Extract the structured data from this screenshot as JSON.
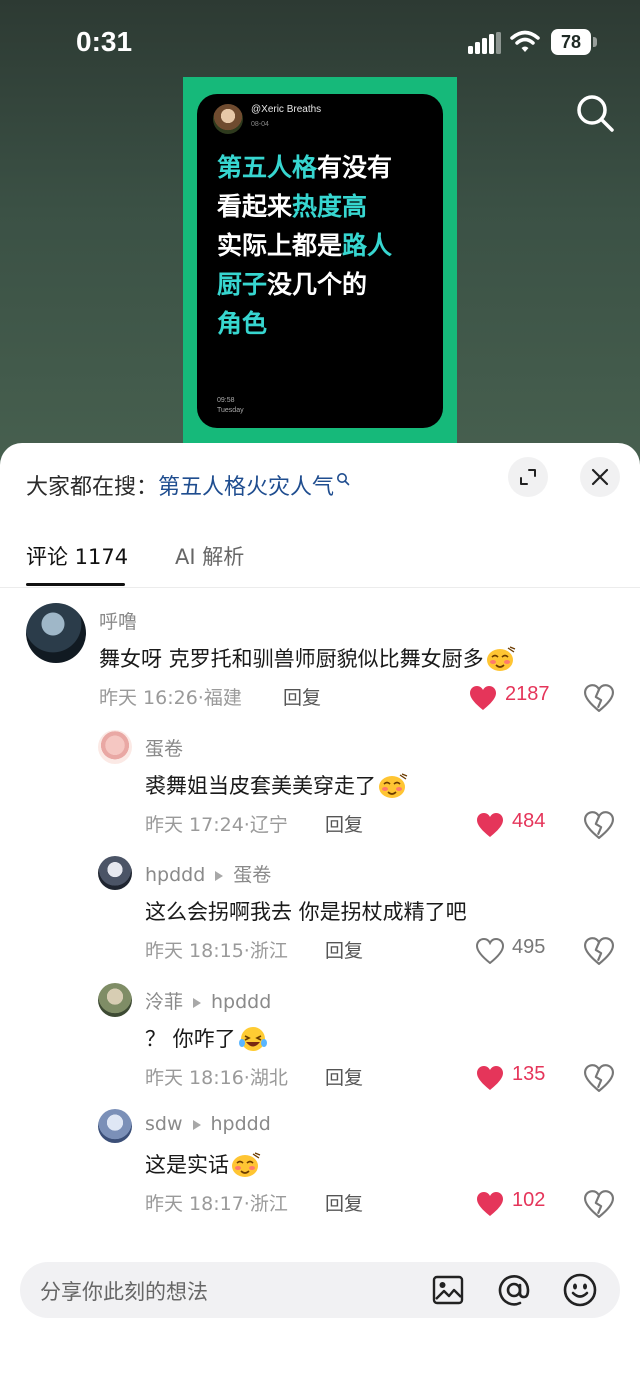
{
  "status": {
    "time": "0:31",
    "battery": "78"
  },
  "post": {
    "handle": "@Xeric Breaths",
    "date": "08-04",
    "lines": [
      [
        {
          "t": "第五人格",
          "hl": true
        },
        {
          "t": "有没有",
          "hl": false
        }
      ],
      [
        {
          "t": "看起来",
          "hl": false
        },
        {
          "t": "热度高",
          "hl": true
        }
      ],
      [
        {
          "t": "实际上都是",
          "hl": false
        },
        {
          "t": "路人",
          "hl": true
        }
      ],
      [
        {
          "t": "厨子",
          "hl": true
        },
        {
          "t": "没几个的",
          "hl": false
        }
      ],
      [
        {
          "t": "角色",
          "hl": true
        }
      ]
    ],
    "footer_time": "09:58",
    "footer_day": "Tuesday"
  },
  "sheet": {
    "search_prefix": "大家都在搜：",
    "search_term": "第五人格火灾人气",
    "tabs": {
      "comments": "评论 1174",
      "ai": "AI 解析"
    },
    "reply_label": "回复",
    "input_placeholder": "分享你此刻的想法"
  },
  "comments": [
    {
      "name": "呼噜",
      "reply_to": "",
      "text": "舞女呀 克罗托和驯兽师厨貌似比舞女厨多",
      "emoji": true,
      "time": "昨天 16:26",
      "location": "福建",
      "likes": "2187",
      "liked": true,
      "level": 0
    },
    {
      "name": "蛋卷",
      "reply_to": "",
      "text": "裘舞姐当皮套美美穿走了",
      "emoji": true,
      "time": "昨天 17:24",
      "location": "辽宁",
      "likes": "484",
      "liked": true,
      "level": 1
    },
    {
      "name": "hpddd",
      "reply_to": "蛋卷",
      "text": "这么会拐啊我去 你是拐杖成精了吧",
      "emoji": false,
      "time": "昨天 18:15",
      "location": "浙江",
      "likes": "495",
      "liked": false,
      "level": 1
    },
    {
      "name": "泠菲",
      "reply_to": "hpddd",
      "text": "？ 你咋了",
      "emoji": "laugh",
      "time": "昨天 18:16",
      "location": "湖北",
      "likes": "135",
      "liked": true,
      "level": 1
    },
    {
      "name": "sdw",
      "reply_to": "hpddd",
      "text": "这是实话",
      "emoji": true,
      "time": "昨天 18:17",
      "location": "浙江",
      "likes": "102",
      "liked": true,
      "level": 1
    }
  ],
  "colors": {
    "accent_green": "#16b97a",
    "highlight_cyan": "#37d6d0",
    "like_red": "#e5355a",
    "link_blue": "#1f4d8f"
  }
}
